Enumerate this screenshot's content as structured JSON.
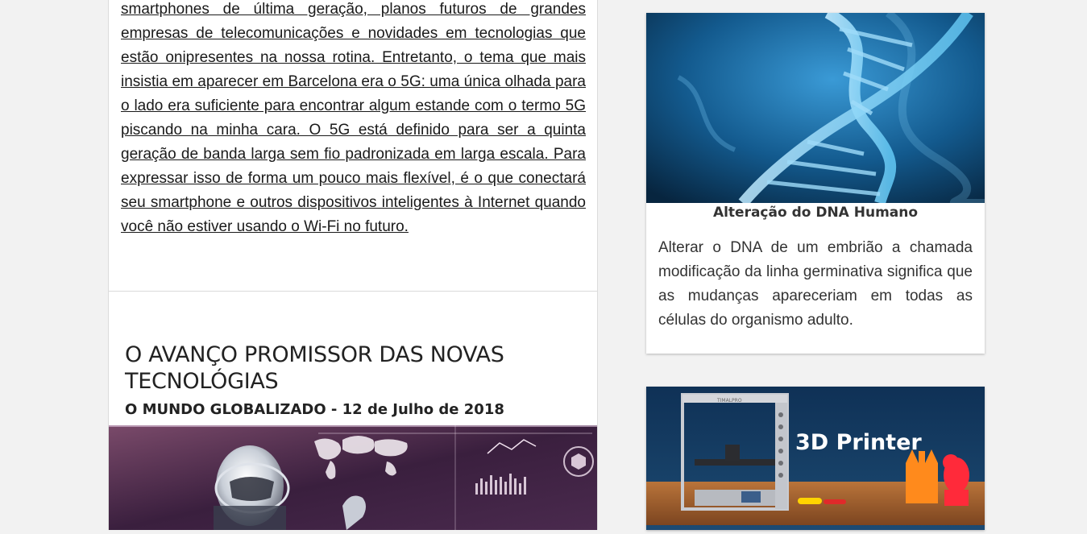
{
  "article": {
    "paragraph": "smartphones de última geração, planos futuros de grandes empresas de telecomunicações e novidades em tecnologias que estão onipresentes na nossa rotina. Entretanto, o tema que mais insistia em aparecer em Barcelona era o 5G: uma única olhada para o lado era suficiente para encontrar algum estande com o termo 5G piscando na minha cara. O 5G está definido para ser a quinta geração de banda larga sem fio padronizada em larga escala. Para expressar isso de forma um pouco mais flexível, é o que conectará seu smartphone e outros dispositivos inteligentes à Internet quando você não estiver usando o Wi-Fi no futuro."
  },
  "post": {
    "title": "O AVANÇO PROMISSOR DAS NOVAS TECNOLÓGIAS",
    "meta": "O MUNDO GLOBALIZADO - 12 de Julho de 2018"
  },
  "sidebar": {
    "cards": [
      {
        "title": "Alteração do DNA Humano",
        "text": "Alterar o DNA de um embrião a chamada modificação da linha germinativa significa que as mudanças apareceriam em todas as células do organismo adulto."
      },
      {
        "image_label": "3D Printer",
        "brand": "TIMALPRO"
      }
    ]
  },
  "colors": {
    "page_bg": "#f2f2f2",
    "card_bg": "#ffffff",
    "dna_blue": "#1a6fa8",
    "printer_bg": "#16304a"
  }
}
